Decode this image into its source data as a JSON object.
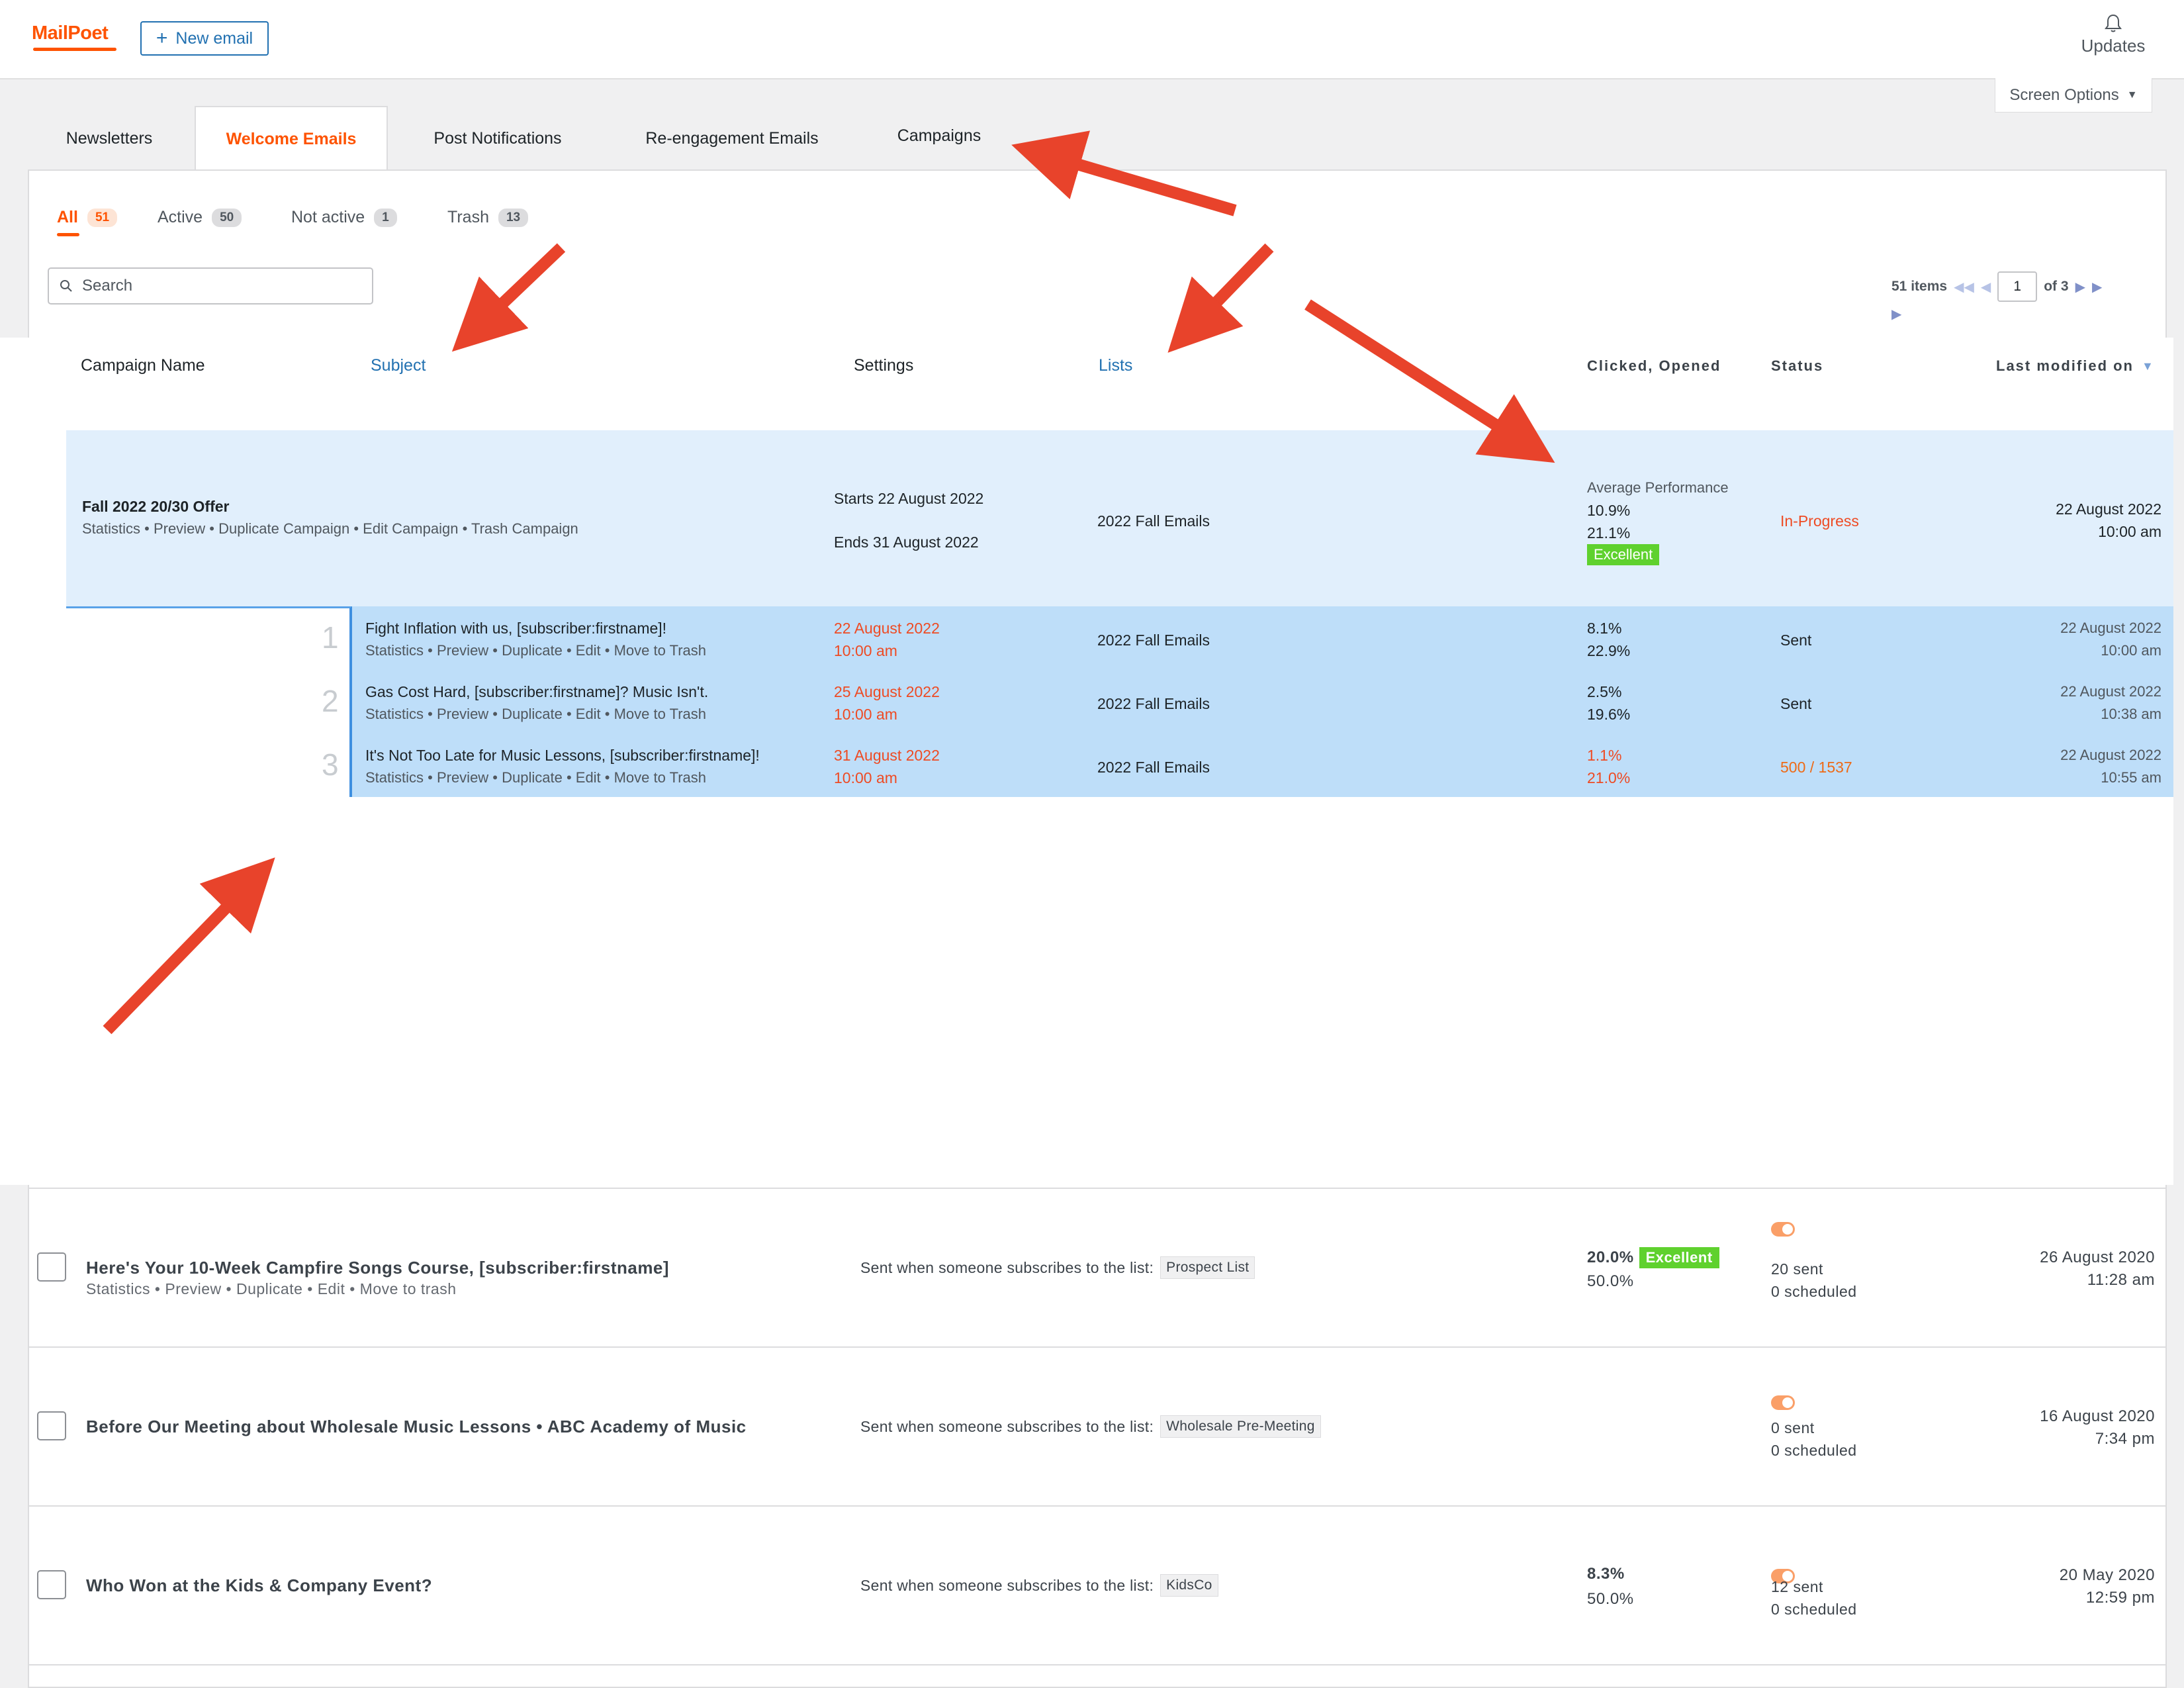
{
  "header": {
    "logo": "MailPoet",
    "new_email_label": "New email",
    "updates_label": "Updates",
    "screen_options_label": "Screen Options"
  },
  "tabs": [
    {
      "label": "Newsletters"
    },
    {
      "label": "Welcome Emails"
    },
    {
      "label": "Post Notifications"
    },
    {
      "label": "Re-engagement Emails"
    },
    {
      "label": "Campaigns"
    }
  ],
  "filters": [
    {
      "label": "All",
      "count": "51"
    },
    {
      "label": "Active",
      "count": "50"
    },
    {
      "label": "Not active",
      "count": "1"
    },
    {
      "label": "Trash",
      "count": "13"
    }
  ],
  "search": {
    "placeholder": "Search"
  },
  "pagination": {
    "items": "51 items",
    "page": "1",
    "of": "of 3"
  },
  "columns": {
    "campaign_name": "Campaign Name",
    "subject": "Subject",
    "settings": "Settings",
    "lists": "Lists",
    "clicked_opened": "Clicked, Opened",
    "status": "Status",
    "last_modified": "Last modified on"
  },
  "campaign": {
    "name": "Fall 2022 20/30 Offer",
    "actions": "Statistics • Preview • Duplicate Campaign • Edit Campaign • Trash Campaign",
    "starts": "Starts 22 August 2022",
    "ends": "Ends 31 August 2022",
    "list": "2022 Fall Emails",
    "perf_label": "Average Performance",
    "clicked": "10.9%",
    "opened": "21.1%",
    "badge": "Excellent",
    "status": "In-Progress",
    "modified_date": "22 August 2022",
    "modified_time": "10:00 am",
    "emails": [
      {
        "num": "1",
        "subject": "Fight Inflation with us, [subscriber:firstname]!",
        "actions": "Statistics • Preview • Duplicate • Edit • Move to Trash",
        "date": "22 August 2022",
        "time": "10:00 am",
        "list": "2022 Fall Emails",
        "clicked": "8.1%",
        "opened": "22.9%",
        "status": "Sent",
        "mod_date": "22 August 2022",
        "mod_time": "10:00 am"
      },
      {
        "num": "2",
        "subject": "Gas Cost Hard, [subscriber:firstname]? Music Isn't.",
        "actions": "Statistics • Preview • Duplicate • Edit • Move to Trash",
        "date": "25 August 2022",
        "time": "10:00 am",
        "list": "2022 Fall Emails",
        "clicked": "2.5%",
        "opened": "19.6%",
        "status": "Sent",
        "mod_date": "22 August 2022",
        "mod_time": "10:38 am"
      },
      {
        "num": "3",
        "subject": "It's Not Too Late for Music Lessons, [subscriber:firstname]!",
        "actions": "Statistics • Preview • Duplicate • Edit • Move to Trash",
        "date": "31 August 2022",
        "time": "10:00 am",
        "list": "2022 Fall Emails",
        "clicked": "1.1%",
        "opened": "21.0%",
        "status": "500 / 1537",
        "mod_date": "22 August 2022",
        "mod_time": "10:55 am"
      }
    ]
  },
  "welcome_rows": [
    {
      "title": "Here's Your 10-Week Campfire Songs Course, [subscriber:firstname]",
      "actions": "Statistics  •  Preview  •  Duplicate  •  Edit  •  Move to trash",
      "setting": "Sent when someone subscribes to the list:",
      "list": "Prospect List",
      "clicked": "20.0%",
      "badge": "Excellent",
      "opened": "50.0%",
      "sent": "20 sent",
      "scheduled": "0 scheduled",
      "mod_date": "26 August 2020",
      "mod_time": "11:28 am"
    },
    {
      "title": "Before Our Meeting about Wholesale Music Lessons • ABC Academy of Music",
      "actions": "",
      "setting": "Sent when someone subscribes to the list:",
      "list": "Wholesale Pre-Meeting",
      "clicked": "",
      "badge": "",
      "opened": "",
      "sent": "0 sent",
      "scheduled": "0 scheduled",
      "mod_date": "16 August 2020",
      "mod_time": "7:34 pm"
    },
    {
      "title": "Who Won at the Kids & Company Event?",
      "actions": "",
      "setting": "Sent when someone subscribes to the list:",
      "list": "KidsCo",
      "clicked": "8.3%",
      "badge": "",
      "opened": "50.0%",
      "sent": "12 sent",
      "scheduled": "0 scheduled",
      "mod_date": "20 May 2020",
      "mod_time": "12:59 pm"
    }
  ],
  "colors": {
    "brand": "#fe5301",
    "link": "#2271b1",
    "annotation_arrow": "#e8432b",
    "excellent": "#5fd12e"
  }
}
